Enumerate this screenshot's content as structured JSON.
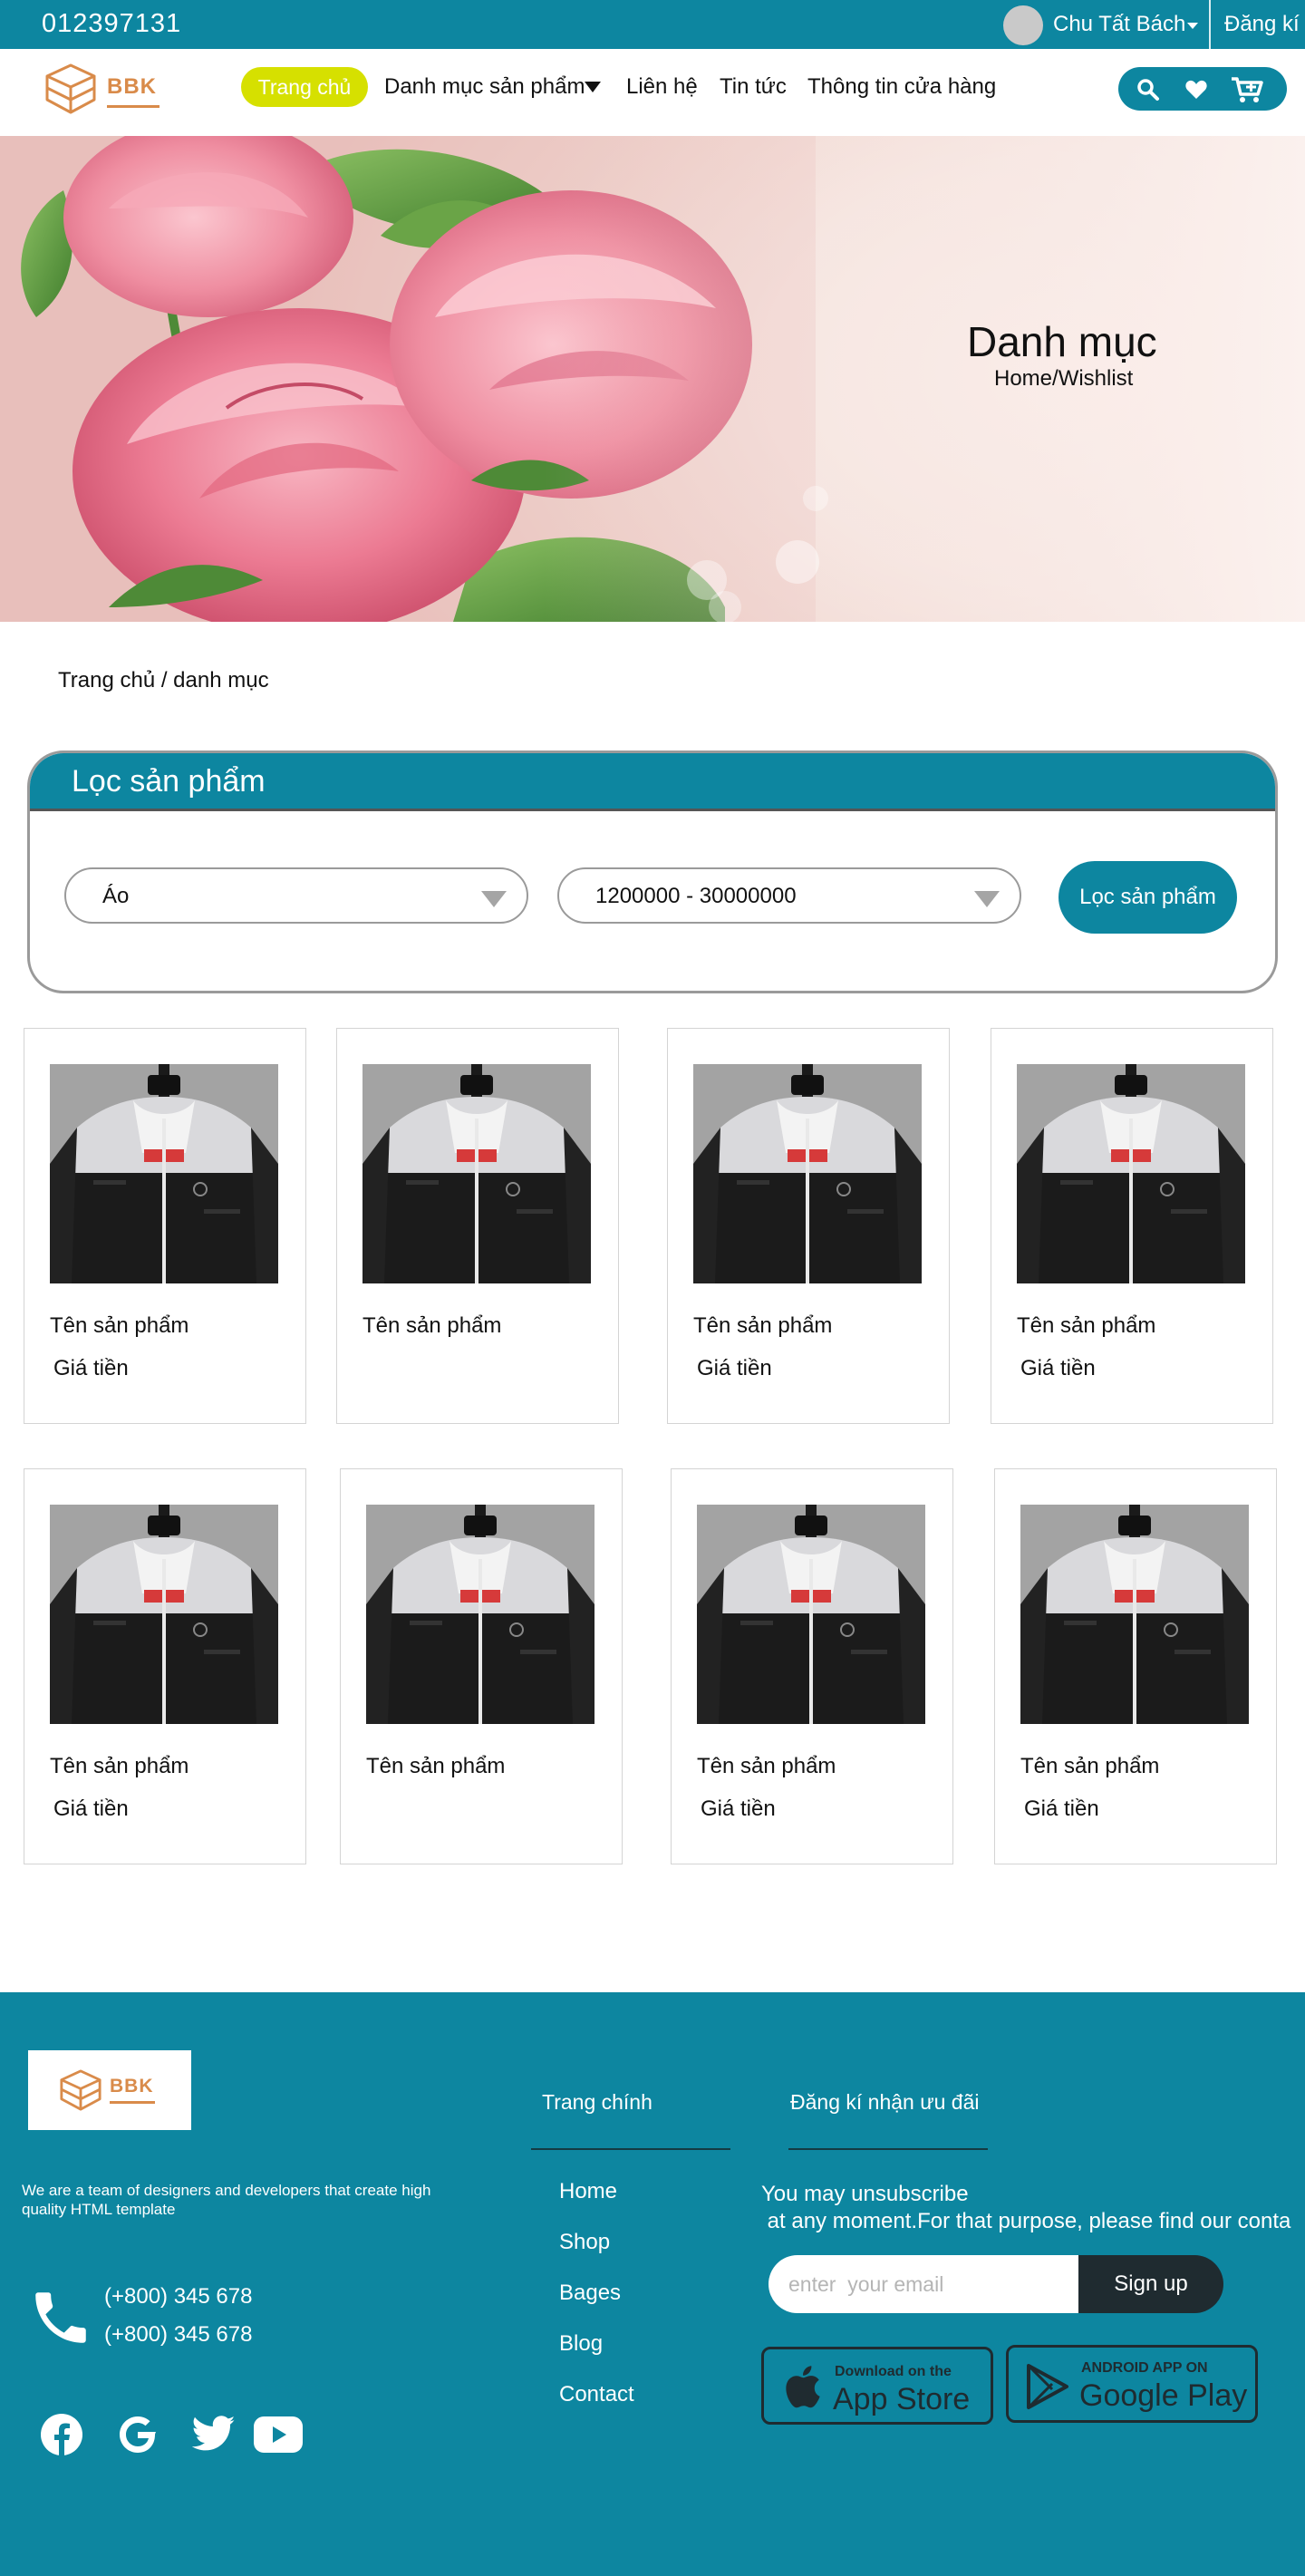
{
  "topbar": {
    "phone": "012397131",
    "user_name": "Chu Tất Bách",
    "register": "Đăng kí"
  },
  "brand": {
    "logo_text": "BBK",
    "color": "#d98b4a"
  },
  "nav": {
    "items": [
      "Trang chủ",
      "Danh mục sản phẩm",
      "Liên hệ",
      "Tin tức",
      "Thông tin cửa hàng"
    ],
    "icons": [
      "search-icon",
      "heart-icon",
      "cart-icon"
    ]
  },
  "hero": {
    "title": "Danh mục",
    "subtitle": "Home/Wishlist"
  },
  "breadcrumb": "Trang chủ / danh mục",
  "filter": {
    "title": "Lọc sản phẩm",
    "category": "Áo",
    "price_range": "1200000 - 30000000",
    "button": "Lọc sản phẩm"
  },
  "products": [
    {
      "name": "Tên sản phẩm",
      "price": "Giá tiền"
    },
    {
      "name": "Tên sản phẩm",
      "price": ""
    },
    {
      "name": "Tên sản phẩm",
      "price": "Giá tiền"
    },
    {
      "name": "Tên sản phẩm",
      "price": "Giá tiền"
    },
    {
      "name": "Tên sản phẩm",
      "price": "Giá tiền"
    },
    {
      "name": "Tên sản phẩm",
      "price": ""
    },
    {
      "name": "Tên sản phẩm",
      "price": "Giá tiền"
    },
    {
      "name": "Tên sản phẩm",
      "price": "Giá tiền"
    }
  ],
  "footer": {
    "description": "We are a team of designers and developers that create high quality HTML template",
    "phones": [
      "(+800) 345 678",
      "(+800) 345 678"
    ],
    "social": [
      "facebook-icon",
      "google-icon",
      "twitter-icon",
      "youtube-icon"
    ],
    "main_title": "Trang chính",
    "links": [
      "Home",
      "Shop",
      "Bages",
      "Blog",
      "Contact"
    ],
    "newsletter_title": "Đăng kí nhận ưu đãi",
    "newsletter_line1": "You may unsubscribe",
    "newsletter_line2": " at any moment.For that purpose, please find our conta",
    "email_placeholder": "enter  your email",
    "signup": "Sign up",
    "app_store_small": "Download on the",
    "app_store_big": "App Store",
    "google_play_small": "ANDROID APP ON",
    "google_play_big": "Google Play"
  },
  "colors": {
    "primary": "#0d86a0",
    "accent_pill": "#d6e000",
    "dark": "#1f2b30"
  }
}
